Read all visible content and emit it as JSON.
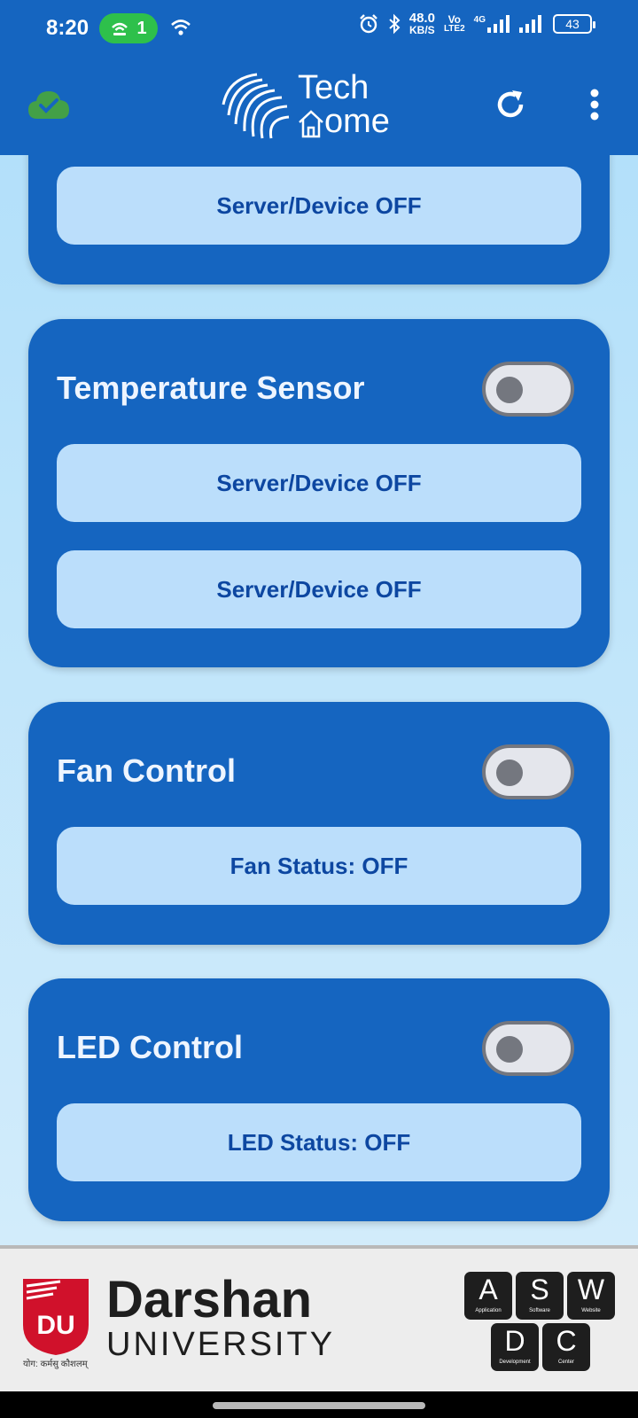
{
  "status_bar": {
    "time": "8:20",
    "hotspot_count": "1",
    "speed_value": "48.0",
    "speed_unit": "KB/S",
    "volte_top": "Vo",
    "volte_bottom": "LTE2",
    "network": "4G",
    "battery": "43"
  },
  "app_bar": {
    "logo_line1": "Tech",
    "logo_line2": "ome",
    "cloud_icon": "cloud-check-icon",
    "refresh_icon": "refresh-icon",
    "menu_icon": "more-vert-icon",
    "accent": "#1565c0"
  },
  "cards": {
    "top": {
      "status": "Server/Device OFF"
    },
    "temperature": {
      "title": "Temperature Sensor",
      "status_1": "Server/Device OFF",
      "status_2": "Server/Device OFF",
      "toggle_on": false
    },
    "fan": {
      "title": "Fan Control",
      "status": "Fan Status: OFF",
      "toggle_on": false
    },
    "led": {
      "title": "LED Control",
      "status": "LED Status: OFF",
      "toggle_on": false
    }
  },
  "footer": {
    "brand_initials": "DU",
    "brand_name": "Darshan",
    "brand_sub": "UNIVERSITY",
    "motto": "योग: कर्मसु कौशलम्",
    "keys": [
      {
        "letter": "A",
        "desc": "Application"
      },
      {
        "letter": "S",
        "desc": "Software"
      },
      {
        "letter": "W",
        "desc": "Website"
      },
      {
        "letter": "D",
        "desc": "Development"
      },
      {
        "letter": "C",
        "desc": "Center"
      }
    ],
    "brand_color": "#d0112b"
  }
}
